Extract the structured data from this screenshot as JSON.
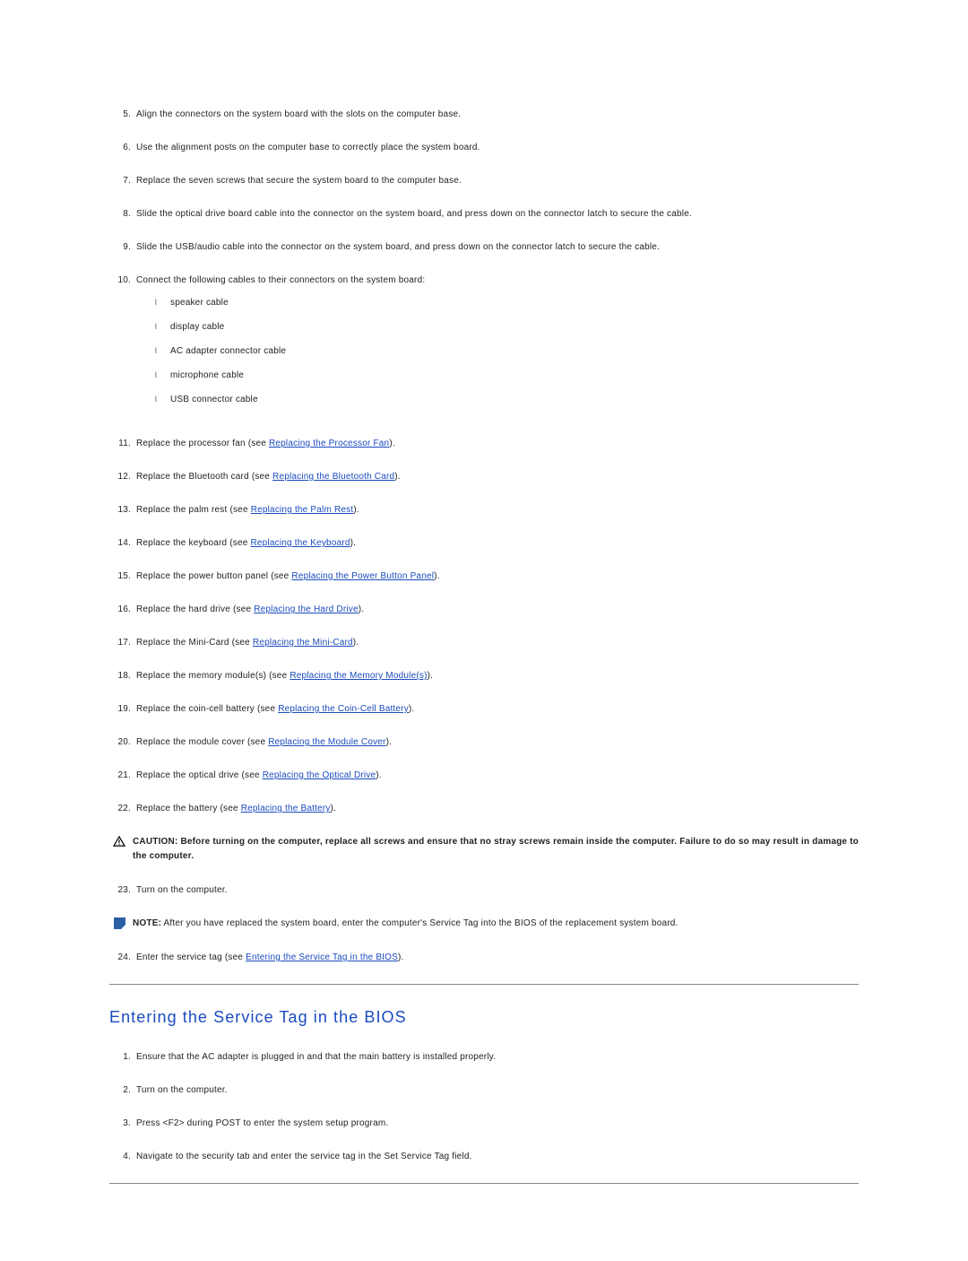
{
  "steps_a": [
    {
      "n": "5.",
      "pre": "Align the connectors on the system board with the slots on the computer base.",
      "link": null,
      "post": null
    },
    {
      "n": "6.",
      "pre": "Use the alignment posts on the computer base to correctly place the system board.",
      "link": null,
      "post": null
    },
    {
      "n": "7.",
      "pre": "Replace the seven screws that secure the system board to the computer base.",
      "link": null,
      "post": null
    },
    {
      "n": "8.",
      "pre": "Slide the optical drive board cable into the connector on the system board, and press down on the connector latch to secure the cable.",
      "link": null,
      "post": null
    },
    {
      "n": "9.",
      "pre": "Slide the USB/audio cable into the connector on the system board, and press down on the connector latch to secure the cable.",
      "link": null,
      "post": null
    },
    {
      "n": "10.",
      "pre": "Connect the following cables to their connectors on the system board:",
      "link": null,
      "post": null,
      "sub": [
        "speaker cable",
        "display cable",
        "AC adapter connector cable",
        "microphone cable",
        "USB connector cable"
      ]
    },
    {
      "n": "11.",
      "pre": "Replace the processor fan (see ",
      "link": "Replacing the Processor Fan",
      "post": ")."
    },
    {
      "n": "12.",
      "pre": "Replace the Bluetooth card (see ",
      "link": "Replacing the Bluetooth Card",
      "post": ")."
    },
    {
      "n": "13.",
      "pre": "Replace the palm rest (see ",
      "link": "Replacing the Palm Rest",
      "post": ")."
    },
    {
      "n": "14.",
      "pre": "Replace the keyboard (see ",
      "link": "Replacing the Keyboard",
      "post": ")."
    },
    {
      "n": "15.",
      "pre": "Replace the power button panel (see ",
      "link": "Replacing the Power Button Panel",
      "post": ")."
    },
    {
      "n": "16.",
      "pre": "Replace the hard drive (see ",
      "link": "Replacing the Hard Drive",
      "post": ")."
    },
    {
      "n": "17.",
      "pre": "Replace the Mini-Card (see ",
      "link": "Replacing the Mini-Card",
      "post": ")."
    },
    {
      "n": "18.",
      "pre": "Replace the memory module(s) (see ",
      "link": "Replacing the Memory Module(s)",
      "post": ")."
    },
    {
      "n": "19.",
      "pre": "Replace the coin-cell battery (see ",
      "link": "Replacing the Coin-Cell Battery",
      "post": ")."
    },
    {
      "n": "20.",
      "pre": "Replace the module cover (see ",
      "link": "Replacing the Module Cover",
      "post": ")."
    },
    {
      "n": "21.",
      "pre": "Replace the optical drive (see ",
      "link": "Replacing the Optical Drive",
      "post": ")."
    },
    {
      "n": "22.",
      "pre": "Replace the battery (see ",
      "link": "Replacing the Battery",
      "post": ")."
    }
  ],
  "caution": {
    "label": "CAUTION:",
    "text": " Before turning on the computer, replace all screws and ensure that no stray screws remain inside the computer. Failure to do so may result in damage to the computer."
  },
  "step23": {
    "n": "23.",
    "text": "Turn on the computer."
  },
  "note": {
    "label": "NOTE:",
    "text": " After you have replaced the system board, enter the computer's Service Tag into the BIOS of the replacement system board."
  },
  "step24": {
    "n": "24.",
    "pre": "Enter the service tag (see ",
    "link": "Entering the Service Tag in the BIOS",
    "post": ")."
  },
  "section_title": "Entering the Service Tag in the BIOS",
  "steps_b": [
    {
      "n": "1.",
      "text": "Ensure that the AC adapter is plugged in and that the main battery is installed properly."
    },
    {
      "n": "2.",
      "text": "Turn on the computer."
    },
    {
      "n": "3.",
      "text": "Press <F2> during POST to enter the system setup program."
    },
    {
      "n": "4.",
      "text": "Navigate to the security tab and enter the service tag in the Set Service Tag field."
    }
  ],
  "bullet_marker": "l"
}
